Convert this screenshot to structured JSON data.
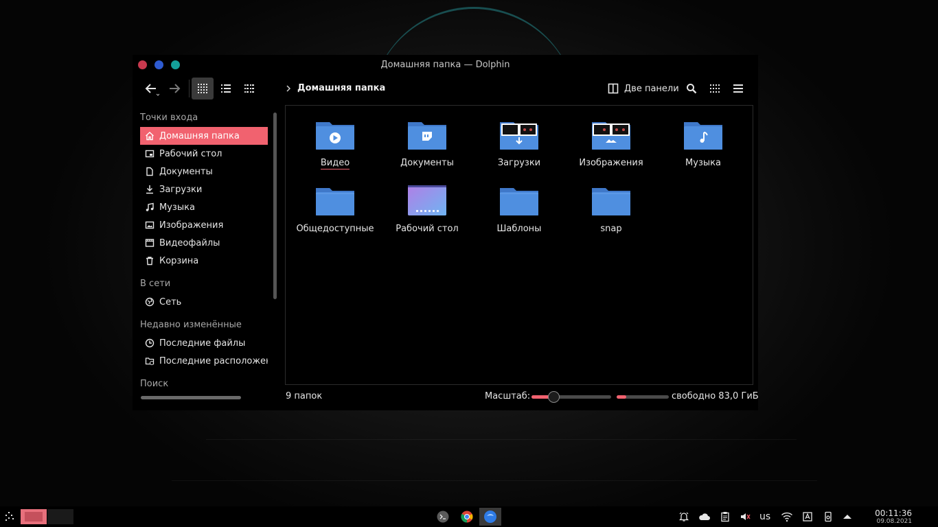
{
  "window": {
    "title": "Домашняя папка — Dolphin",
    "traffic_colors": [
      "#c8394e",
      "#2e5bd1",
      "#14a09a"
    ]
  },
  "toolbar": {
    "back_icon": "arrow-left-icon",
    "forward_icon": "arrow-right-icon",
    "view_modes": [
      "icons-view-icon",
      "details-view-icon",
      "compact-view-icon"
    ],
    "breadcrumb_path": "Домашняя папка",
    "split_label": "Две панели",
    "search_icon": "search-icon",
    "view_menu_icon": "view-options-icon",
    "menu_icon": "hamburger-menu-icon"
  },
  "sidebar": {
    "sections": [
      {
        "title": "Точки входа",
        "items": [
          {
            "label": "Домашняя папка",
            "icon": "home-icon",
            "active": true
          },
          {
            "label": "Рабочий стол",
            "icon": "desktop-icon"
          },
          {
            "label": "Документы",
            "icon": "document-icon"
          },
          {
            "label": "Загрузки",
            "icon": "download-icon"
          },
          {
            "label": "Музыка",
            "icon": "music-icon"
          },
          {
            "label": "Изображения",
            "icon": "image-icon"
          },
          {
            "label": "Видеофайлы",
            "icon": "video-icon"
          },
          {
            "label": "Корзина",
            "icon": "trash-icon"
          }
        ]
      },
      {
        "title": "В сети",
        "items": [
          {
            "label": "Сеть",
            "icon": "network-icon"
          }
        ]
      },
      {
        "title": "Недавно изменённые",
        "items": [
          {
            "label": "Последние файлы",
            "icon": "clock-icon"
          },
          {
            "label": "Последние расположения",
            "icon": "folder-clock-icon"
          }
        ]
      },
      {
        "title": "Поиск",
        "items": []
      }
    ]
  },
  "folders": [
    {
      "label": "Видео",
      "emblem": "play",
      "focused": true
    },
    {
      "label": "Документы",
      "emblem": "doc"
    },
    {
      "label": "Загрузки",
      "emblem": "download"
    },
    {
      "label": "Изображения",
      "emblem": "pictures"
    },
    {
      "label": "Музыка",
      "emblem": "music"
    },
    {
      "label": "Общедоступные",
      "emblem": "none"
    },
    {
      "label": "Рабочий стол",
      "emblem": "desktop"
    },
    {
      "label": "Шаблоны",
      "emblem": "none"
    },
    {
      "label": "snap",
      "emblem": "none"
    }
  ],
  "status": {
    "count": "9 папок",
    "zoom_label": "Масштаб:",
    "zoom_level": 0.28,
    "free_space_used_fraction": 0.18,
    "free_space": "свободно 83,0 ГиБ"
  },
  "taskbar": {
    "keyboard_layout": "us",
    "time": "00:11:36",
    "date": "09.08.2021",
    "accent": "#f1626f",
    "folder_blue": "#4f8fe0"
  }
}
